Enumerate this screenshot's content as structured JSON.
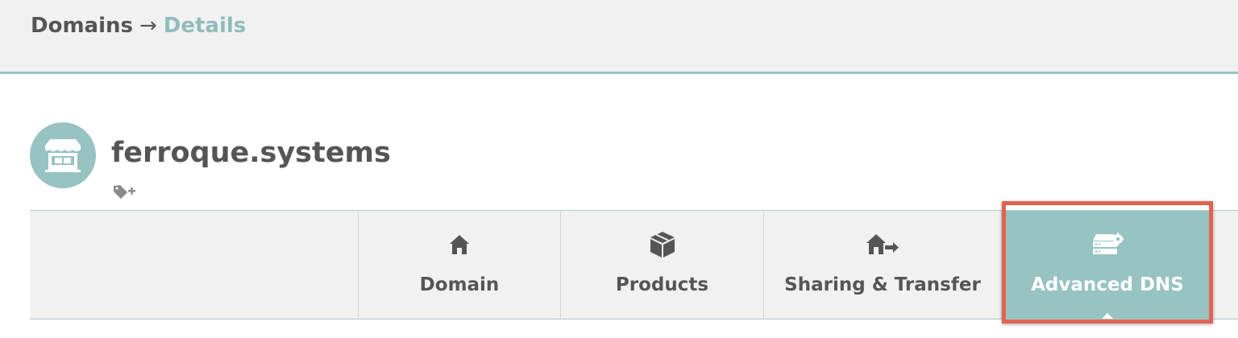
{
  "breadcrumb": {
    "parent": "Domains",
    "separator": "→",
    "current": "Details"
  },
  "domain": {
    "name": "ferroque.systems",
    "avatar_icon": "storefront-icon",
    "tag_icon": "tag-add-icon"
  },
  "tabs": [
    {
      "label": "Domain",
      "icon": "home-icon",
      "active": false
    },
    {
      "label": "Products",
      "icon": "box-icon",
      "active": false
    },
    {
      "label": "Sharing & Transfer",
      "icon": "home-share-icon",
      "active": false
    },
    {
      "label": "Advanced DNS",
      "icon": "server-gear-icon",
      "active": true
    }
  ],
  "colors": {
    "accent": "#97c3c2",
    "breadcrumb_current": "#8fbcbb",
    "text": "#555555",
    "highlight": "#e0644f",
    "background_bar": "#f1f1f1"
  }
}
